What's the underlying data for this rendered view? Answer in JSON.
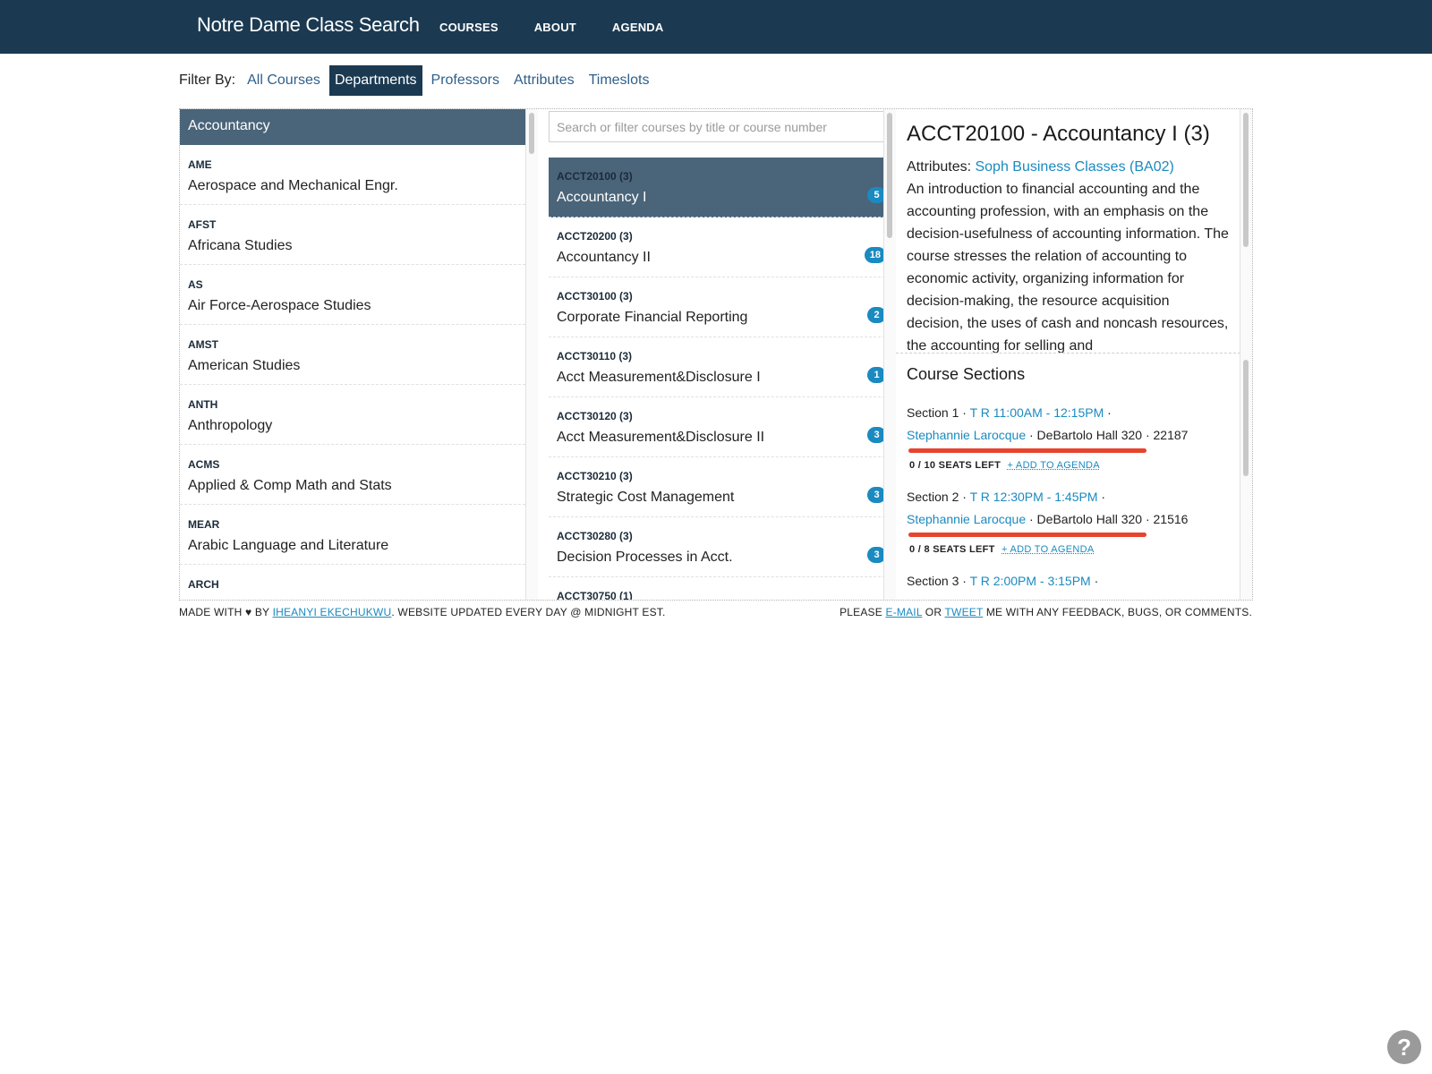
{
  "header": {
    "brand": "Notre Dame Class Search",
    "nav": [
      "COURSES",
      "ABOUT",
      "AGENDA"
    ],
    "bg_color": "#1b3a52"
  },
  "filter": {
    "label": "Filter By:",
    "options": [
      "All Courses",
      "Departments",
      "Professors",
      "Attributes",
      "Timeslots"
    ],
    "active": "Departments"
  },
  "departments": {
    "selected": "Accountancy",
    "items": [
      {
        "code": "AME",
        "name": "Aerospace and Mechanical Engr."
      },
      {
        "code": "AFST",
        "name": "Africana Studies"
      },
      {
        "code": "AS",
        "name": "Air Force-Aerospace Studies"
      },
      {
        "code": "AMST",
        "name": "American Studies"
      },
      {
        "code": "ANTH",
        "name": "Anthropology"
      },
      {
        "code": "ACMS",
        "name": "Applied & Comp Math and Stats"
      },
      {
        "code": "MEAR",
        "name": "Arabic Language and Literature"
      },
      {
        "code": "ARCH",
        "name": ""
      }
    ]
  },
  "courses": {
    "search_placeholder": "Search or filter courses by title or course number",
    "items": [
      {
        "code": "ACCT20100 (3)",
        "title": "Accountancy I",
        "count": "5"
      },
      {
        "code": "ACCT20200 (3)",
        "title": "Accountancy II",
        "count": "18"
      },
      {
        "code": "ACCT30100 (3)",
        "title": "Corporate Financial Reporting",
        "count": "2"
      },
      {
        "code": "ACCT30110 (3)",
        "title": "Acct Measurement&Disclosure I",
        "count": "1"
      },
      {
        "code": "ACCT30120 (3)",
        "title": "Acct Measurement&Disclosure II",
        "count": "3"
      },
      {
        "code": "ACCT30210 (3)",
        "title": "Strategic Cost Management",
        "count": "3"
      },
      {
        "code": "ACCT30280 (3)",
        "title": "Decision Processes in Acct.",
        "count": "3"
      },
      {
        "code": "ACCT30750 (1)",
        "title": "",
        "count": ""
      }
    ]
  },
  "detail": {
    "title": "ACCT20100 - Accountancy I (3)",
    "attributes_label": "Attributes:",
    "attributes_value": "Soph Business Classes (BA02)",
    "description": "An introduction to financial accounting and the accounting profession, with an emphasis on the decision-usefulness of accounting information. The course stresses the relation of accounting to economic activity, organizing information for decision-making, the resource acquisition decision, the uses of cash and noncash resources, the accounting for selling and",
    "sections_title": "Course Sections",
    "sections": [
      {
        "label": "Section 1 ·",
        "time": "T R 11:00AM - 12:15PM",
        "instructor": "Stephannie Larocque",
        "location": "· DeBartolo Hall 320 · 22187",
        "seats": "0 / 10 SEATS LEFT",
        "add": "+ ADD TO AGENDA"
      },
      {
        "label": "Section 2 ·",
        "time": "T R 12:30PM - 1:45PM",
        "instructor": "Stephannie Larocque",
        "location": "· DeBartolo Hall 320 · 21516",
        "seats": "0 / 8 SEATS LEFT",
        "add": "+ ADD TO AGENDA"
      },
      {
        "label": "Section 3 ·",
        "time": "T R 2:00PM - 3:15PM",
        "instructor": "",
        "location": "",
        "seats": "",
        "add": ""
      }
    ]
  },
  "footer": {
    "left_pre": "MADE WITH ♥ BY ",
    "left_author": "IHEANYI EKECHUKWU",
    "left_post": ". WEBSITE UPDATED EVERY DAY @ MIDNIGHT EST.",
    "right_pre": "PLEASE ",
    "right_email": "E-MAIL",
    "right_mid": " OR ",
    "right_tweet": "TWEET",
    "right_post": " ME WITH ANY FEEDBACK, BUGS, OR COMMENTS."
  },
  "help_icon": "?",
  "colors": {
    "accent": "#1a8ac0",
    "selected_row": "#4a6479",
    "highlight_bar": "#e8432d"
  }
}
